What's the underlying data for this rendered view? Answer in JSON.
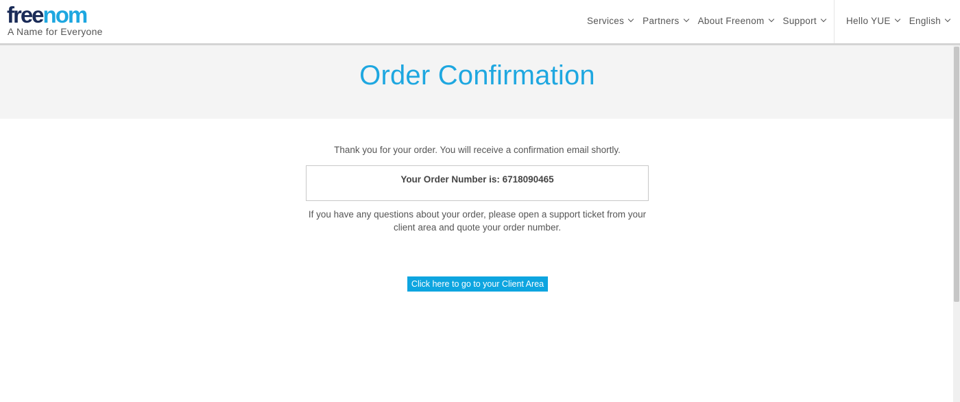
{
  "brand": {
    "logo_part1": "free",
    "logo_part2": "nom",
    "tagline": "A Name for Everyone",
    "colors": {
      "dark": "#1a2b57",
      "accent": "#1ea7e0"
    }
  },
  "nav": {
    "main": [
      {
        "label": "Services",
        "icon": "chevron-down-icon"
      },
      {
        "label": "Partners",
        "icon": "chevron-down-icon"
      },
      {
        "label": "About Freenom",
        "icon": "chevron-down-icon"
      },
      {
        "label": "Support",
        "icon": "chevron-down-icon"
      }
    ],
    "user": [
      {
        "label": "Hello YUE",
        "icon": "chevron-down-icon"
      },
      {
        "label": "English",
        "icon": "chevron-down-icon"
      }
    ]
  },
  "page": {
    "title": "Order Confirmation",
    "thanks": "Thank you for your order. You will receive a confirmation email shortly.",
    "order_number_line": "Your Order Number is: 6718090465",
    "questions": "If you have any questions about your order, please open a support ticket from your client area and quote your order number.",
    "client_area_button": "Click here to go to your Client Area"
  }
}
